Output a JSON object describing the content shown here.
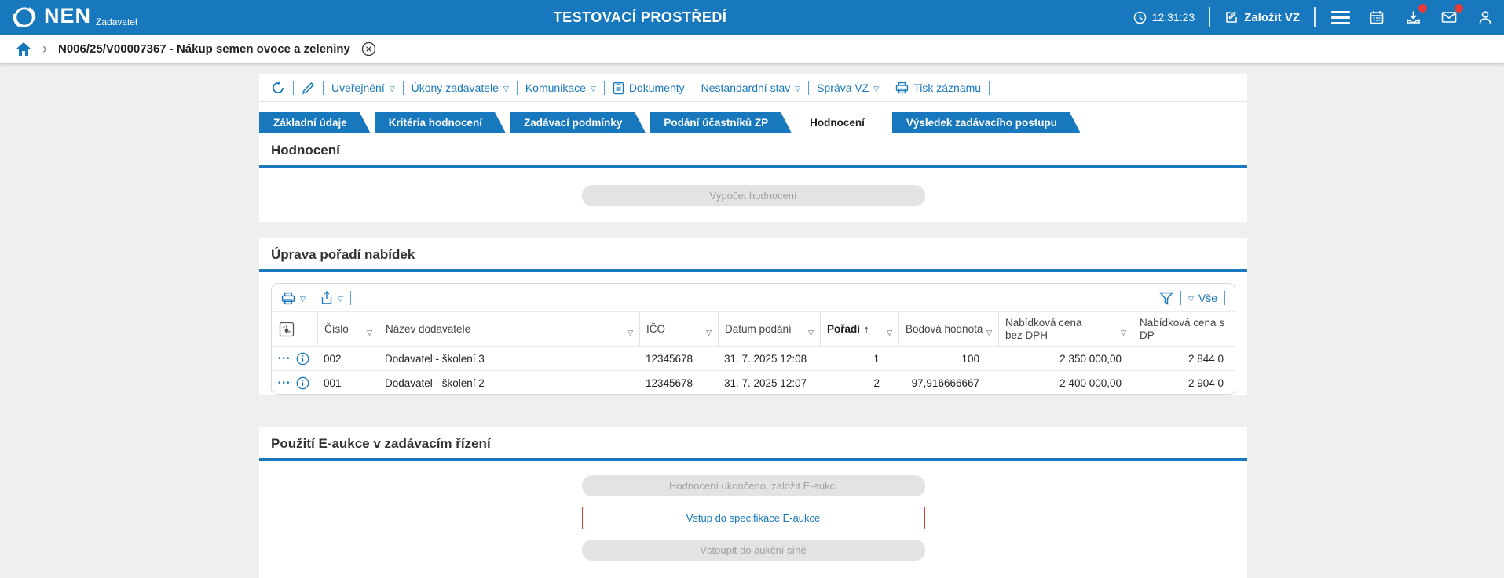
{
  "colors": {
    "accent": "#1878be",
    "badge": "#e53b3b",
    "alert_border": "#e04034"
  },
  "icons": {
    "caret": "▽",
    "sort_asc": "↑",
    "chevron": "›",
    "overflow_dots": "•••"
  },
  "app_header": {
    "brand": "NEN",
    "brand_sub": "Zadavatel",
    "env_title": "TESTOVACÍ PROSTŘEDÍ",
    "time": "12:31:23",
    "create_vz": "Založit VZ"
  },
  "breadcrumb": {
    "record_title": "N006/25/V00007367 - Nákup semen ovoce a zeleniny"
  },
  "record_toolbar": {
    "items": [
      {
        "label": "Uveřejnění"
      },
      {
        "label": "Úkony zadavatele"
      },
      {
        "label": "Komunikace"
      },
      {
        "label": "Dokumenty"
      },
      {
        "label": "Nestandardní stav"
      },
      {
        "label": "Správa VZ"
      },
      {
        "label": "Tisk záznamu"
      }
    ]
  },
  "tabs": [
    {
      "label": "Základní údaje"
    },
    {
      "label": "Kritéria hodnocení"
    },
    {
      "label": "Zadávací podmínky"
    },
    {
      "label": "Podání účastníků ZP"
    },
    {
      "label": "Hodnocení",
      "active": true
    },
    {
      "label": "Výsledek zadávacího postupu"
    }
  ],
  "evaluation_section": {
    "title": "Hodnocení",
    "calc_button": "Výpočet hodnocení"
  },
  "order_section": {
    "title": "Úprava pořadí nabídek",
    "grid_filter_all": "Vše",
    "columns": {
      "cislo": "Číslo",
      "nazev": "Název dodavatele",
      "ico": "IČO",
      "datum": "Datum podání",
      "poradi": "Pořadí",
      "body": "Bodová hodnota",
      "cena_bez": "Nabídková cena bez DPH",
      "cena_s": "Nabídková cena s DP"
    },
    "rows": [
      {
        "cislo": "002",
        "nazev": "Dodavatel - školení 3",
        "ico": "12345678",
        "datum": "31. 7. 2025 12:08",
        "poradi": "1",
        "body": "100",
        "cena_bez": "2 350 000,00",
        "cena_s": "2 844 0"
      },
      {
        "cislo": "001",
        "nazev": "Dodavatel - školení 2",
        "ico": "12345678",
        "datum": "31. 7. 2025 12:07",
        "poradi": "2",
        "body": "97,916666667",
        "cena_bez": "2 400 000,00",
        "cena_s": "2 904 0"
      }
    ]
  },
  "eauction_section": {
    "title": "Použití E-aukce v zadávacím řízení",
    "buttons": [
      {
        "label": "Hodnocení ukončeno, založit E-aukci",
        "state": "disabled"
      },
      {
        "label": "Vstup do specifikace E-aukce",
        "state": "highlighted"
      },
      {
        "label": "Vstoupit do aukční síně",
        "state": "disabled"
      }
    ]
  }
}
